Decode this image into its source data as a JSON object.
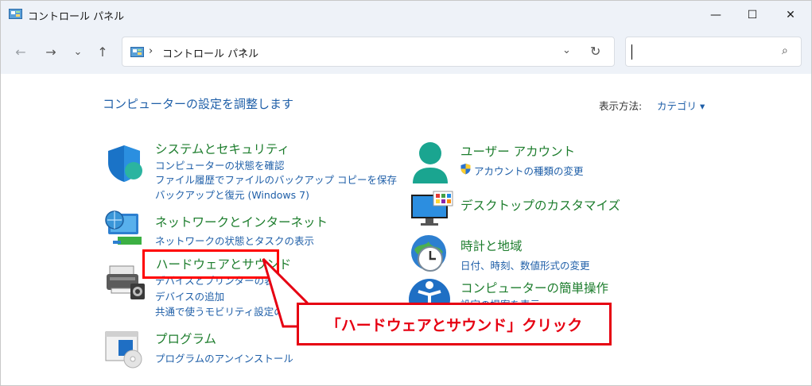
{
  "window": {
    "title": "コントロール パネル",
    "minimize_glyph": "—",
    "maximize_glyph": "☐",
    "close_glyph": "✕"
  },
  "nav": {
    "back_glyph": "←",
    "forward_glyph": "→",
    "recent_glyph": "⌄",
    "up_glyph": "↑",
    "address_sep1": "›",
    "address_text": "コントロール パネル",
    "address_sep2": "›",
    "address_dropdown_glyph": "⌄",
    "refresh_glyph": "↻",
    "search_placeholder": "",
    "search_glyph": "⌕"
  },
  "content": {
    "heading": "コンピューターの設定を調整します",
    "view_by_label": "表示方法:",
    "view_by_value": "カテゴリ ▾"
  },
  "categories_left": [
    {
      "title": "システムとセキュリティ",
      "links": [
        "コンピューターの状態を確認",
        "ファイル履歴でファイルのバックアップ コピーを保存",
        "バックアップと復元 (Windows 7)"
      ],
      "icon": "shield-icon"
    },
    {
      "title": "ネットワークとインターネット",
      "links": [
        "ネットワークの状態とタスクの表示"
      ],
      "icon": "network-icon"
    },
    {
      "title": "ハードウェアとサウンド",
      "links": [
        "デバイスとプリンターの表示",
        "デバイスの追加",
        "共通で使うモビリティ設定の調整"
      ],
      "icon": "printer-icon"
    },
    {
      "title": "プログラム",
      "links": [
        "プログラムのアンインストール"
      ],
      "icon": "programs-icon"
    }
  ],
  "categories_right": [
    {
      "title": "ユーザー アカウント",
      "links": [
        "アカウントの種類の変更"
      ],
      "icon": "user-icon"
    },
    {
      "title": "デスクトップのカスタマイズ",
      "links": [],
      "icon": "monitor-icon"
    },
    {
      "title": "時計と地域",
      "links": [
        "日付、時刻、数値形式の変更"
      ],
      "icon": "clock-globe-icon"
    },
    {
      "title": "コンピューターの簡単操作",
      "links": [
        "設定の提案を表示"
      ],
      "icon": "ease-of-access-icon"
    }
  ],
  "annotation": {
    "callout_text": "「ハードウェアとサウンド」クリック"
  },
  "colors": {
    "title_green": "#1d7d2d",
    "link_blue": "#1f5fa8",
    "annotation_red": "#e60012",
    "chrome_bg": "#eef2f8"
  }
}
